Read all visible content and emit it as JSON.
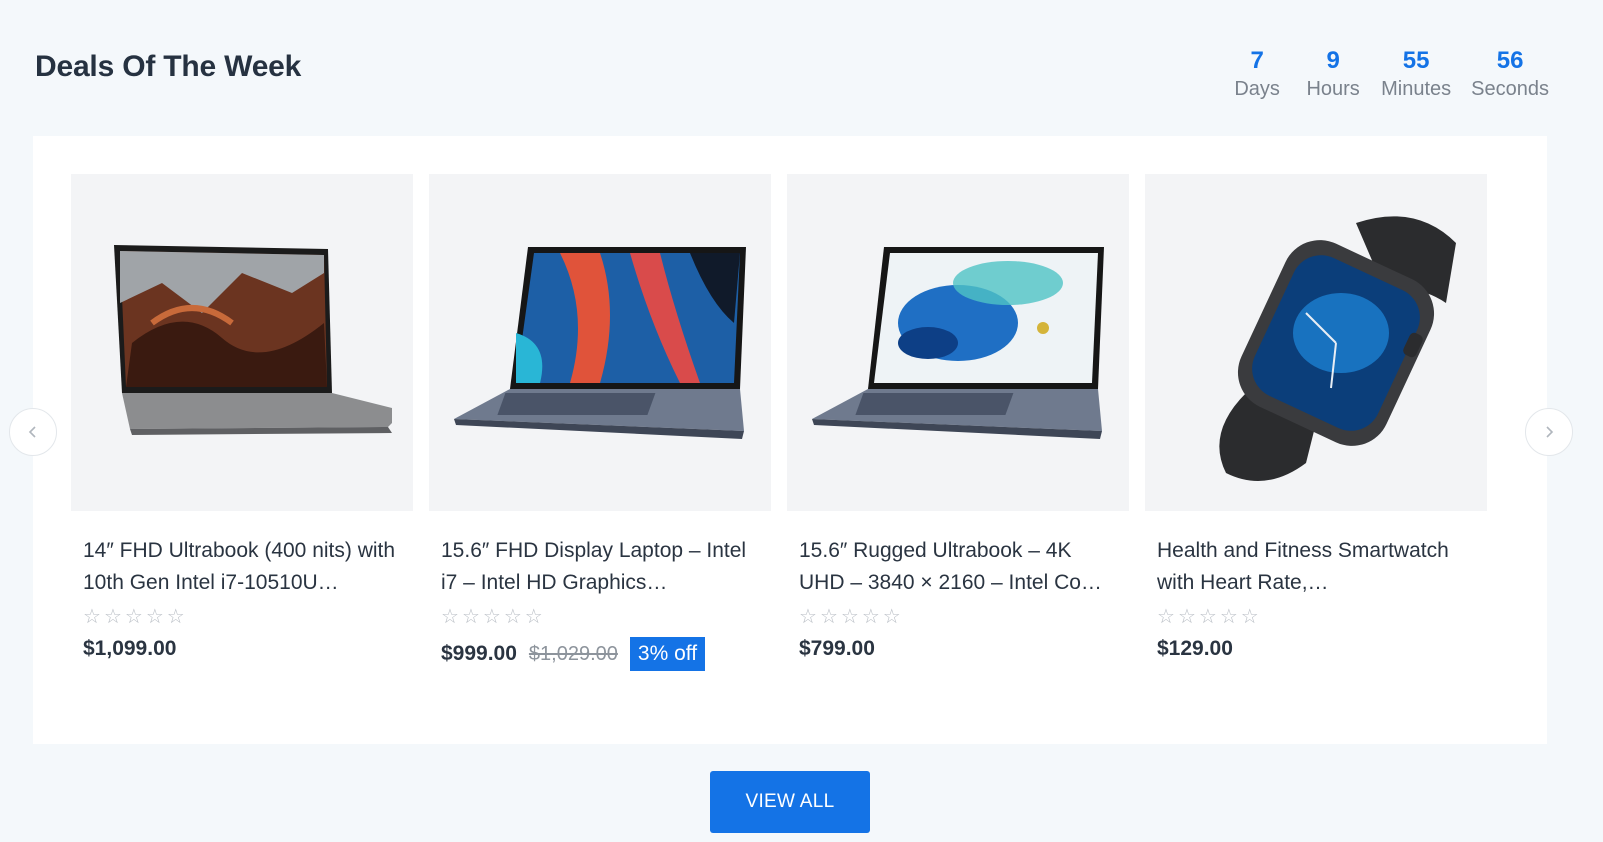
{
  "section": {
    "title": "Deals Of The Week"
  },
  "countdown": [
    {
      "value": "7",
      "label": "Days"
    },
    {
      "value": "9",
      "label": "Hours"
    },
    {
      "value": "55",
      "label": "Minutes"
    },
    {
      "value": "56",
      "label": "Seconds"
    }
  ],
  "products": [
    {
      "title": "14″ FHD Ultrabook (400 nits) with 10th Gen Intel i7-10510U…",
      "rating": 0,
      "price": "$1,099.00",
      "image": "laptop-canyon-wallpaper"
    },
    {
      "title": "15.6″ FHD Display Laptop – Intel i7 – Intel HD Graphics…",
      "rating": 0,
      "price": "$999.00",
      "old_price": "$1,029.00",
      "discount": "3% off",
      "image": "laptop-abstract-wallpaper"
    },
    {
      "title": "15.6″ Rugged Ultrabook – 4K UHD – 3840 × 2160 – Intel Co…",
      "rating": 0,
      "price": "$799.00",
      "image": "laptop-blue-splash-wallpaper"
    },
    {
      "title": "Health and Fitness Smartwatch with Heart Rate,…",
      "rating": 0,
      "price": "$129.00",
      "image": "smartwatch-black-band"
    }
  ],
  "view_all_label": "VIEW ALL",
  "colors": {
    "accent": "#1473e6",
    "background": "#f4f8fb",
    "card_image_bg": "#f3f4f6"
  }
}
